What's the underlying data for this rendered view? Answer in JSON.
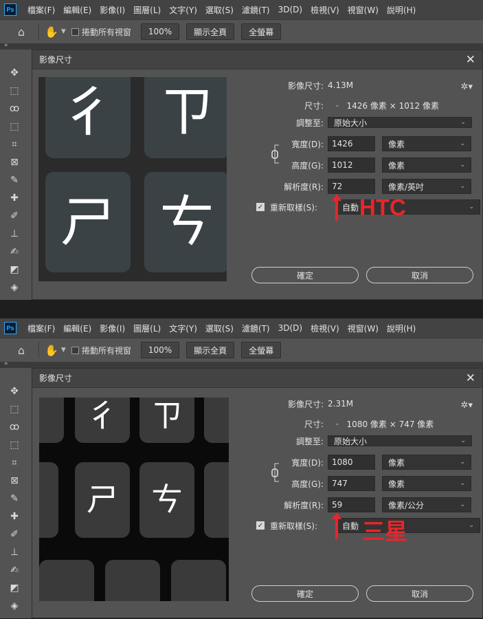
{
  "app": {
    "logo": "Ps"
  },
  "menu": [
    "檔案(F)",
    "編輯(E)",
    "影像(I)",
    "圖層(L)",
    "文字(Y)",
    "選取(S)",
    "濾鏡(T)",
    "3D(D)",
    "檢視(V)",
    "視窗(W)",
    "說明(H)"
  ],
  "options": {
    "scroll_all": "捲動所有視窗",
    "zoom": "100%",
    "fit_screen": "顯示全頁",
    "fill_screen": "全螢幕"
  },
  "dialog": {
    "title": "影像尺寸",
    "close": "✕",
    "image_size_label": "影像尺寸:",
    "dimensions_label": "尺寸:",
    "fit_to_label": "調整至:",
    "fit_to_value": "原始大小",
    "width_label": "寬度(D):",
    "height_label": "高度(G):",
    "resolution_label": "解析度(R):",
    "resample_label": "重新取樣(S):",
    "resample_value": "自動",
    "unit_pixels": "像素",
    "ok": "確定",
    "cancel": "取消"
  },
  "shots": [
    {
      "image_size": "4.13M",
      "dimensions": "1426 像素 × 1012 像素",
      "width": "1426",
      "height": "1012",
      "resolution": "72",
      "resolution_unit": "像素/英吋",
      "annotation": "HTC",
      "preview": {
        "background": "#2b2b2b",
        "glyphs": [
          "彳",
          "ㄗ",
          "ㄕ",
          "ㄘ"
        ]
      }
    },
    {
      "image_size": "2.31M",
      "dimensions": "1080 像素 × 747 像素",
      "width": "1080",
      "height": "747",
      "resolution": "59",
      "resolution_unit": "像素/公分",
      "annotation": "三星",
      "preview": {
        "background": "#0a0a0a",
        "glyphs": [
          "彳",
          "ㄗ",
          "ㄕ",
          "ㄘ"
        ]
      }
    }
  ],
  "colors": {
    "annotation": "#e6262c",
    "panel": "#535353",
    "bar": "#434343"
  }
}
